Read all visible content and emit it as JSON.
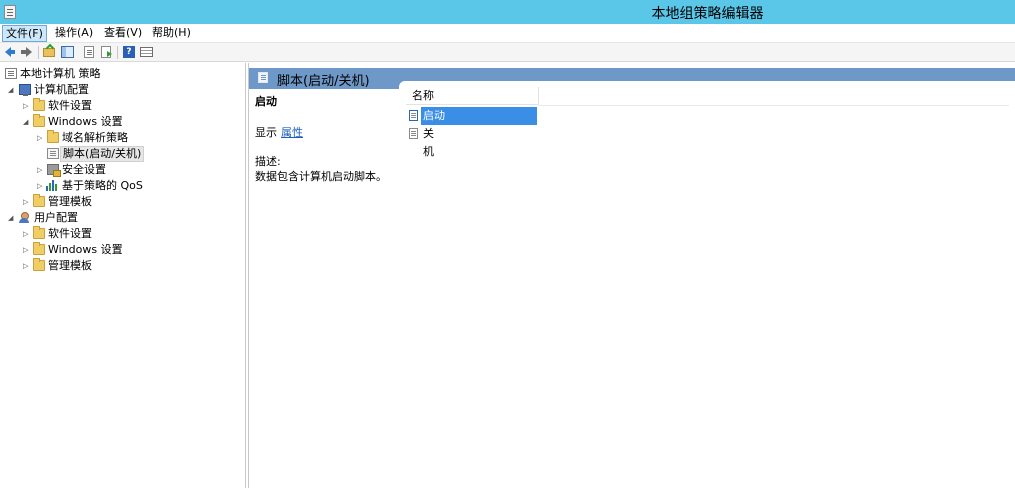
{
  "window": {
    "title": "本地组策略编辑器"
  },
  "menubar": {
    "items": [
      "文件(F)",
      "操作(A)",
      "查看(V)",
      "帮助(H)"
    ],
    "active_index": 0
  },
  "toolbar": {
    "buttons": [
      "back-icon",
      "forward-icon",
      "up-folder-icon",
      "show-hide-tree-icon",
      "properties-icon",
      "export-list-icon",
      "help-icon",
      "extended-view-icon"
    ]
  },
  "tree": {
    "root": "本地计算机 策略",
    "computer_config": "计算机配置",
    "cc_software": "软件设置",
    "cc_windows": "Windows 设置",
    "cc_dns": "域名解析策略",
    "cc_scripts": "脚本(启动/关机)",
    "cc_security": "安全设置",
    "cc_qos": "基于策略的 QoS",
    "cc_admin": "管理模板",
    "user_config": "用户配置",
    "uc_software": "软件设置",
    "uc_windows": "Windows 设置",
    "uc_admin": "管理模板"
  },
  "pane": {
    "header_title": "脚本(启动/关机)",
    "detail_title": "启动",
    "show_label": "显示",
    "properties_link": "属性",
    "description_label": "描述:",
    "description_text": "数据包含计算机启动脚本。",
    "column_name": "名称",
    "items": [
      "启动",
      "关机"
    ],
    "selected_index": 0
  },
  "colors": {
    "titlebar": "#5bc7e8",
    "pane_header": "#6d98c7",
    "selection": "#3a8ee6",
    "link": "#1a5fbf"
  }
}
